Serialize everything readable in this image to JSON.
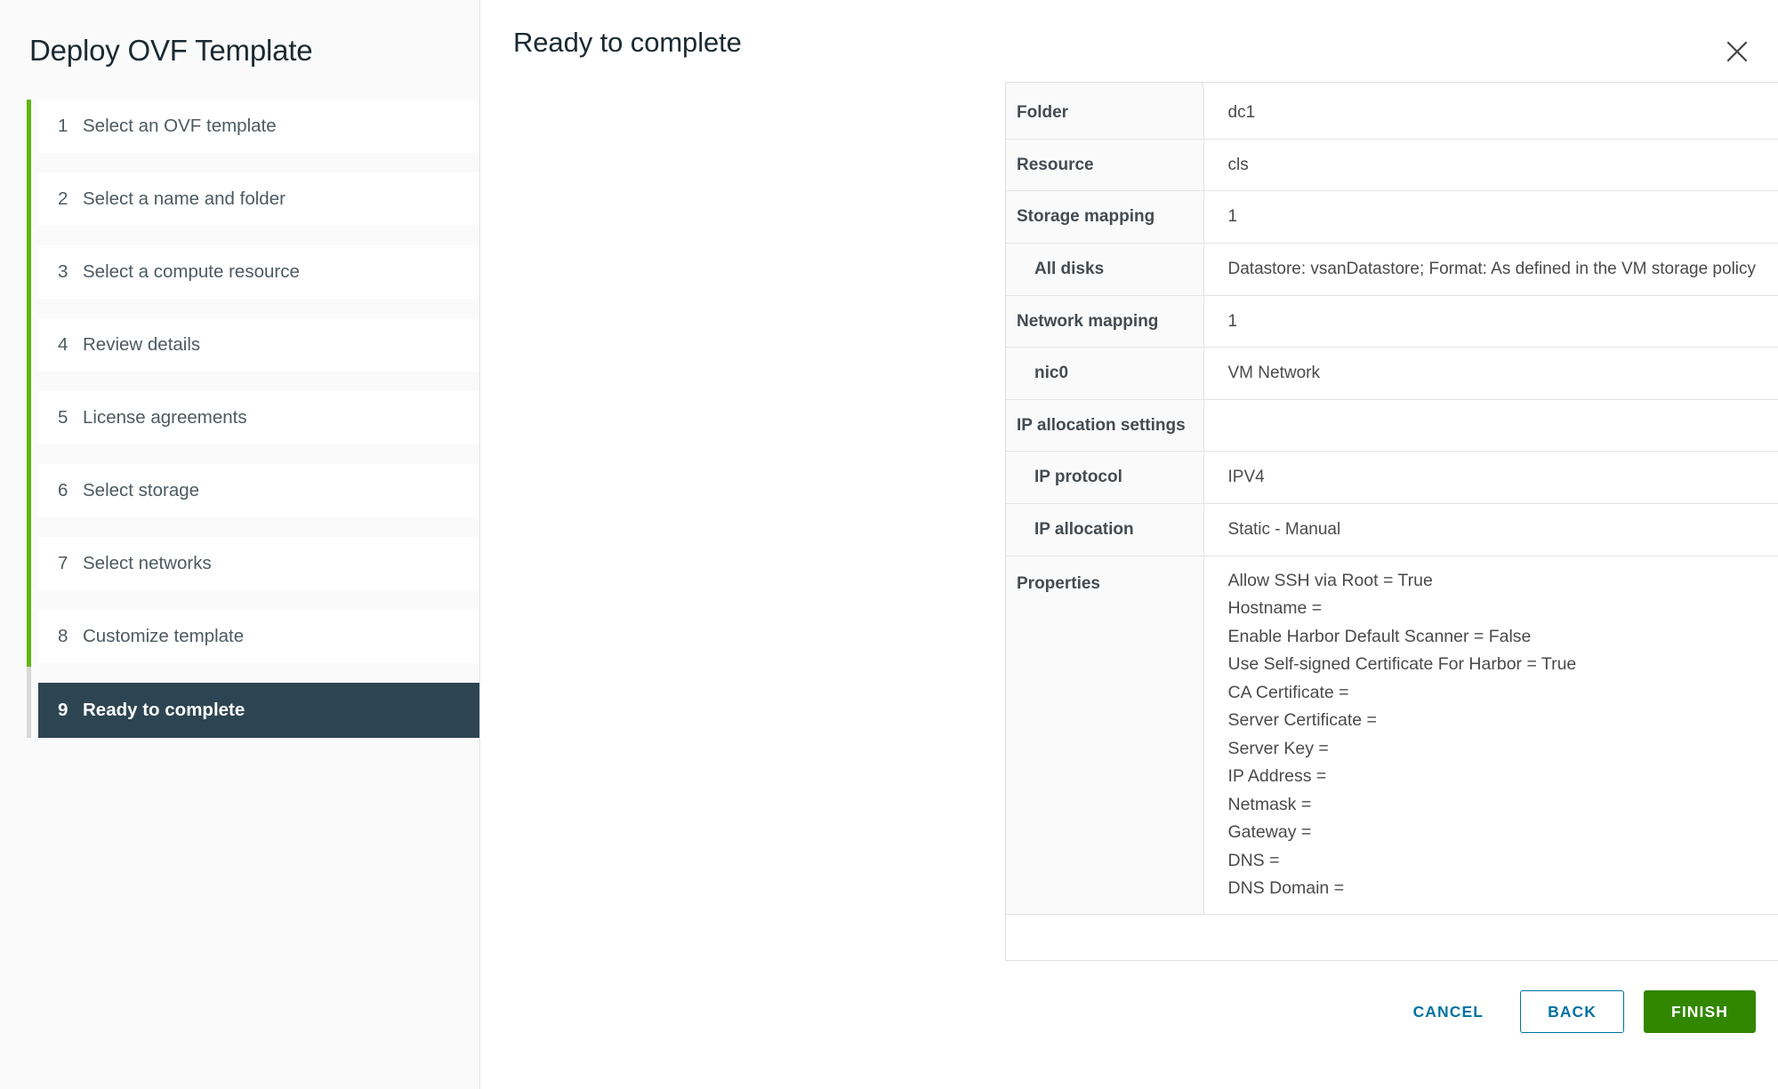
{
  "wizard": {
    "title": "Deploy OVF Template",
    "steps": [
      {
        "num": "1",
        "label": "Select an OVF template"
      },
      {
        "num": "2",
        "label": "Select a name and folder"
      },
      {
        "num": "3",
        "label": "Select a compute resource"
      },
      {
        "num": "4",
        "label": "Review details"
      },
      {
        "num": "5",
        "label": "License agreements"
      },
      {
        "num": "6",
        "label": "Select storage"
      },
      {
        "num": "7",
        "label": "Select networks"
      },
      {
        "num": "8",
        "label": "Customize template"
      },
      {
        "num": "9",
        "label": "Ready to complete"
      }
    ],
    "active_step_index": 8,
    "progress_color": "#60b515",
    "active_step_color": "#2d4552"
  },
  "page": {
    "title": "Ready to complete",
    "close_icon": "close-icon"
  },
  "summary": {
    "rows": [
      {
        "label": "Folder",
        "value": "dc1",
        "indent": false
      },
      {
        "label": "Resource",
        "value": "cls",
        "indent": false
      },
      {
        "label": "Storage mapping",
        "value": "1",
        "indent": false
      },
      {
        "label": "All disks",
        "value": "Datastore: vsanDatastore; Format: As defined in the VM storage policy",
        "indent": true
      },
      {
        "label": "Network mapping",
        "value": "1",
        "indent": false
      },
      {
        "label": "nic0",
        "value": "VM Network",
        "indent": true
      },
      {
        "label": "IP allocation settings",
        "value": "",
        "indent": false
      },
      {
        "label": "IP protocol",
        "value": "IPV4",
        "indent": true
      },
      {
        "label": "IP allocation",
        "value": "Static - Manual",
        "indent": true
      }
    ],
    "properties_label": "Properties",
    "properties": [
      "Allow SSH via Root = True",
      "Hostname =",
      "Enable Harbor Default Scanner = False",
      "Use Self-signed Certificate For Harbor = True",
      "CA Certificate =",
      "Server Certificate =",
      "Server Key =",
      "IP Address =",
      "Netmask =",
      "Gateway =",
      "DNS =",
      "DNS Domain ="
    ]
  },
  "footer": {
    "cancel_label": "CANCEL",
    "back_label": "BACK",
    "finish_label": "FINISH",
    "finish_color": "#318700",
    "link_color": "#0072a3"
  }
}
